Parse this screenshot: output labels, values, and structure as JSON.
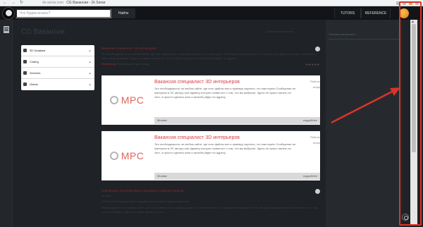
{
  "browser": {
    "url_domain": "dv-sonar.com",
    "tab_title": "CG Вакансии - 2k Sonar"
  },
  "header": {
    "search_placeholder": "Что будем искать?",
    "search_button": "Найти",
    "nav": [
      "TUTORS",
      "REFERENCE"
    ]
  },
  "page": {
    "title": "CG Вакансии",
    "subtitle": "Дизайнеры вакансии"
  },
  "filters": [
    {
      "label": "3D Графика",
      "icon": "cube-icon"
    },
    {
      "label": "Coding",
      "icon": "code-icon"
    },
    {
      "label": "Services",
      "icon": "briefcase-icon"
    },
    {
      "label": "Global",
      "icon": "globe-icon"
    }
  ],
  "right_column": {
    "title": "Похожие материалы"
  },
  "post1": {
    "title": "Вакансия специалист 3D интерьеров",
    "body": "Это необходимость на любом сайте, где есть файлы или к примеру скрипты, что нам нужно. Сообщения на материал в ЛС автору или Админу которое оповестит о том, что вы выбрали. Здесь не нужно писать ни чего, а просто сделать клик и жалоба уйдет по адресу.",
    "meta_prefix": "Интерьеры",
    "meta_suffix": "Публикация 3 дня назад"
  },
  "cards": [
    {
      "brand": "MPC",
      "title": "Вакансия специалист 3D интерьеров",
      "body": "Это необходимость на любом сайте, где есть файлы или к примеру скрипты, что нам нужно Сообщения на материал в ЛС автору или Админу которое оповестит о том, что вы выбрали. Здесь не нужно писать ни чего, а просто сделать клик и жалоба уйдет по адресу.",
      "side1": "Работа",
      "side2": "инфо",
      "footer": "Москва",
      "more": "подробнее"
    },
    {
      "brand": "MPC",
      "title": "Вакансия специалист 3D интерьеров",
      "body": "Это необходимость на любом сайте, где есть файлы или к примеру скрипты, что нам нужно Сообщения на материал в ЛС автору или Админу которое оповестит о том, что вы выбрали. Здесь не нужно писать ни чего, а просто сделать клик и жалоба уйдет по адресу.",
      "side1": "Работа",
      "side2": "инфо",
      "footer": "Москва",
      "more": "подробнее"
    }
  ],
  "post2": {
    "title": "Специалист интерактивного дизайна (создания модели",
    "meta": "Москва",
    "body": "В России CG-студии ищут сотрудников в разные отделы компании.",
    "body2": "Необходимость на любом сайте, где есть файлы или к примеру скрипты, что нам нужно. Сообщения на материал в ЛС автору или Админу которое оповестит о том, что вы выбрали. Здесь не нужно писать ни чего."
  }
}
